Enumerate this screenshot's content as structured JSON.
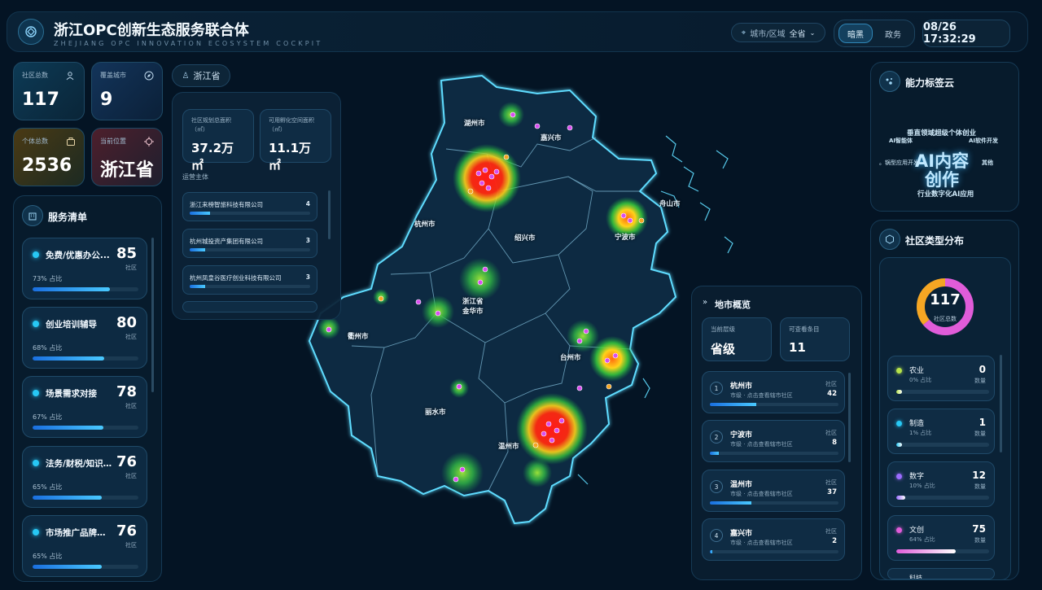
{
  "header": {
    "title": "浙江OPC创新生态服务联合体",
    "subtitle": "ZHEJIANG OPC INNOVATION ECOSYSTEM COCKPIT",
    "filter_label": "城市/区域",
    "filter_value": "全省",
    "mode_dark": "暗黑",
    "mode_gov": "政务",
    "datetime": "08/26 17:32:29"
  },
  "stats": {
    "community_total_label": "社区总数",
    "community_total": "117",
    "cities_label": "覆盖城市",
    "cities": "9",
    "individuals_label": "个体总数",
    "individuals": "2536",
    "location_label": "当前位置",
    "location": "浙江省"
  },
  "region_tag": "浙江省",
  "service_list": {
    "title": "服务清单",
    "items": [
      {
        "name": "免费/优惠办公...",
        "count": "85",
        "unit": "社区",
        "pct_text": "73% 占比",
        "pct": 73
      },
      {
        "name": "创业培训辅导",
        "count": "80",
        "unit": "社区",
        "pct_text": "68% 占比",
        "pct": 68
      },
      {
        "name": "场景需求对接",
        "count": "78",
        "unit": "社区",
        "pct_text": "67% 占比",
        "pct": 67
      },
      {
        "name": "法务/财税/知识...",
        "count": "76",
        "unit": "社区",
        "pct_text": "65% 占比",
        "pct": 65
      },
      {
        "name": "市场推广品牌宣...",
        "count": "76",
        "unit": "社区",
        "pct_text": "65% 占比",
        "pct": 65
      }
    ]
  },
  "province_panel": {
    "area_label": "社区规划总面积（㎡）",
    "area_value": "37.2万㎡",
    "space_label": "可用孵化空间面积（㎡）",
    "space_value": "11.1万㎡",
    "operators_label": "运营主体",
    "operators": [
      {
        "name": "浙江来榜智旅科技有限公司",
        "count": "4",
        "pct": 17
      },
      {
        "name": "杭州城投资产集团有限公司",
        "count": "3",
        "pct": 13
      },
      {
        "name": "杭州凤皇谷医疗创业科技有限公司",
        "count": "3",
        "pct": 13
      }
    ]
  },
  "map": {
    "cities": [
      {
        "name": "湖州市"
      },
      {
        "name": "嘉兴市"
      },
      {
        "name": "舟山市"
      },
      {
        "name": "杭州市"
      },
      {
        "name": "绍兴市"
      },
      {
        "name": "宁波市"
      },
      {
        "name": "浙江省\n金华市"
      },
      {
        "name": "衢州市"
      },
      {
        "name": "台州市"
      },
      {
        "name": "丽水市"
      },
      {
        "name": "温州市"
      }
    ]
  },
  "city_overview": {
    "title": "地市概览",
    "level_label": "当前层级",
    "level_value": "省级",
    "viewable_label": "可查看条目",
    "viewable_value": "11",
    "items": [
      {
        "rank": "1",
        "name": "杭州市",
        "sub": "市级 · 点击查看辖市社区",
        "unit": "社区",
        "count": "42",
        "pct": 36
      },
      {
        "rank": "2",
        "name": "宁波市",
        "sub": "市级 · 点击查看辖市社区",
        "unit": "社区",
        "count": "8",
        "pct": 7
      },
      {
        "rank": "3",
        "name": "温州市",
        "sub": "市级 · 点击查看辖市社区",
        "unit": "社区",
        "count": "37",
        "pct": 32
      },
      {
        "rank": "4",
        "name": "嘉兴市",
        "sub": "市级 · 点击查看辖市社区",
        "unit": "社区",
        "count": "2",
        "pct": 2
      }
    ]
  },
  "tag_cloud": {
    "title": "能力标签云",
    "tags": [
      "垂直领域超级个体创业",
      "AI智能体",
      "AI软件开发",
      "AI内容",
      "创作",
      "其他",
      "行业数字化AI应用"
    ],
    "partial": [
      "。锅型应用开发"
    ]
  },
  "type_distribution": {
    "title": "社区类型分布",
    "total": "117",
    "total_label": "社区总数",
    "items": [
      {
        "name": "农业",
        "pct_text": "0% 占比",
        "count": "0",
        "unit": "数量",
        "color": "#b6e34a",
        "pct": 0
      },
      {
        "name": "制造",
        "pct_text": "1% 占比",
        "count": "1",
        "unit": "数量",
        "color": "#27c8f5",
        "pct": 1
      },
      {
        "name": "数字",
        "pct_text": "10% 占比",
        "count": "12",
        "unit": "数量",
        "color": "#9b6cff",
        "pct": 10
      },
      {
        "name": "文创",
        "pct_text": "64% 占比",
        "count": "75",
        "unit": "数量",
        "color": "#e05cd9",
        "pct": 64
      }
    ],
    "more": "科技"
  },
  "colors": {
    "accent": "#27c8f5",
    "bg": "#041424",
    "orange": "#f5a623",
    "pink": "#d94ef0"
  }
}
